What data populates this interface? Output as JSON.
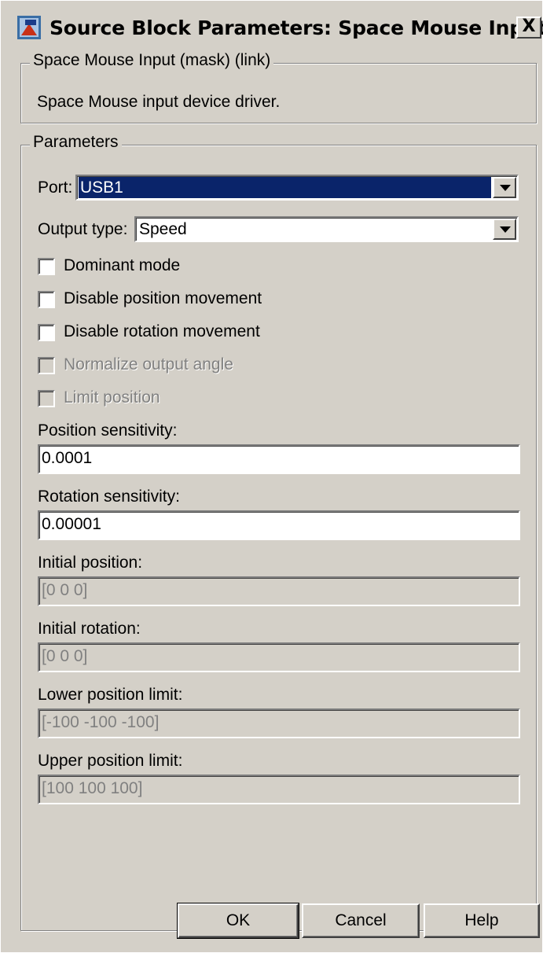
{
  "window": {
    "title": "Source Block Parameters: Space Mouse Input",
    "close_label": "X"
  },
  "description_group": {
    "legend": "Space Mouse Input (mask) (link)",
    "text": "Space Mouse input device driver."
  },
  "parameters": {
    "legend": "Parameters",
    "port": {
      "label": "Port:",
      "value": "USB1"
    },
    "output_type": {
      "label": "Output type:",
      "value": "Speed"
    },
    "checkboxes": [
      {
        "label": "Dominant mode",
        "checked": false,
        "enabled": true
      },
      {
        "label": "Disable position movement",
        "checked": false,
        "enabled": true
      },
      {
        "label": "Disable rotation movement",
        "checked": false,
        "enabled": true
      },
      {
        "label": "Normalize output angle",
        "checked": false,
        "enabled": false
      },
      {
        "label": "Limit position",
        "checked": false,
        "enabled": false
      }
    ],
    "fields": [
      {
        "label": "Position sensitivity:",
        "value": "0.0001",
        "enabled": true
      },
      {
        "label": "Rotation sensitivity:",
        "value": "0.00001",
        "enabled": true
      },
      {
        "label": "Initial position:",
        "value": "[0 0 0]",
        "enabled": false
      },
      {
        "label": "Initial rotation:",
        "value": "[0 0 0]",
        "enabled": false
      },
      {
        "label": "Lower position limit:",
        "value": "[-100 -100 -100]",
        "enabled": false
      },
      {
        "label": "Upper position limit:",
        "value": "[100 100 100]",
        "enabled": false
      }
    ]
  },
  "buttons": {
    "ok": "OK",
    "cancel": "Cancel",
    "help": "Help"
  }
}
